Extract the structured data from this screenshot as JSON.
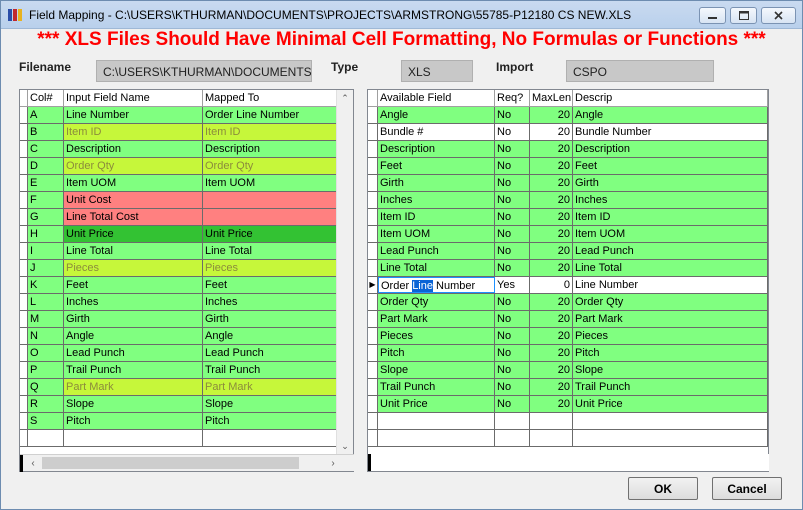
{
  "window": {
    "title": "Field Mapping - C:\\USERS\\KTHURMAN\\DOCUMENTS\\PROJECTS\\ARMSTRONG\\55785-P12180 CS NEW.XLS",
    "warning": "*** XLS Files Should Have Minimal Cell Formatting, No Formulas or Functions ***"
  },
  "form": {
    "filename_label": "Filename",
    "filename_value": "C:\\USERS\\KTHURMAN\\DOCUMENTS\\",
    "type_label": "Type",
    "type_value": "XLS",
    "import_label": "Import",
    "import_value": "CSPO"
  },
  "left_grid": {
    "headers": [
      "Col#",
      "Input Field Name",
      "Mapped To"
    ],
    "rows": [
      {
        "col": "A",
        "input": "Line Number",
        "mapped": "Order Line Number",
        "style": "g"
      },
      {
        "col": "B",
        "input": "Item ID",
        "mapped": "Item ID",
        "style": "y"
      },
      {
        "col": "C",
        "input": "Description",
        "mapped": "Description",
        "style": "g"
      },
      {
        "col": "D",
        "input": "Order Qty",
        "mapped": "Order Qty",
        "style": "y"
      },
      {
        "col": "E",
        "input": "Item UOM",
        "mapped": "Item UOM",
        "style": "g"
      },
      {
        "col": "F",
        "input": "Unit Cost",
        "mapped": "",
        "style": "r"
      },
      {
        "col": "G",
        "input": "Line Total Cost",
        "mapped": "",
        "style": "r"
      },
      {
        "col": "H",
        "input": "Unit Price",
        "mapped": "Unit Price",
        "style": "dg"
      },
      {
        "col": "I",
        "input": "Line Total",
        "mapped": "Line Total",
        "style": "g"
      },
      {
        "col": "J",
        "input": "Pieces",
        "mapped": "Pieces",
        "style": "y"
      },
      {
        "col": "K",
        "input": "Feet",
        "mapped": "Feet",
        "style": "g"
      },
      {
        "col": "L",
        "input": "Inches",
        "mapped": "Inches",
        "style": "g"
      },
      {
        "col": "M",
        "input": "Girth",
        "mapped": "Girth",
        "style": "g"
      },
      {
        "col": "N",
        "input": "Angle",
        "mapped": "Angle",
        "style": "g"
      },
      {
        "col": "O",
        "input": "Lead Punch",
        "mapped": "Lead Punch",
        "style": "g"
      },
      {
        "col": "P",
        "input": "Trail Punch",
        "mapped": "Trail Punch",
        "style": "g"
      },
      {
        "col": "Q",
        "input": "Part Mark",
        "mapped": "Part Mark",
        "style": "y"
      },
      {
        "col": "R",
        "input": "Slope",
        "mapped": "Slope",
        "style": "g"
      },
      {
        "col": "S",
        "input": "Pitch",
        "mapped": "Pitch",
        "style": "g"
      }
    ]
  },
  "right_grid": {
    "headers": [
      "Available Field",
      "Req?",
      "MaxLen",
      "Descrip"
    ],
    "rows": [
      {
        "field": "Angle",
        "req": "No",
        "maxlen": "20",
        "descrip": "Angle",
        "style": "g"
      },
      {
        "field": "Bundle #",
        "req": "No",
        "maxlen": "20",
        "descrip": "Bundle Number",
        "style": "w"
      },
      {
        "field": "Description",
        "req": "No",
        "maxlen": "20",
        "descrip": "Description",
        "style": "g"
      },
      {
        "field": "Feet",
        "req": "No",
        "maxlen": "20",
        "descrip": "Feet",
        "style": "g"
      },
      {
        "field": "Girth",
        "req": "No",
        "maxlen": "20",
        "descrip": "Girth",
        "style": "g"
      },
      {
        "field": "Inches",
        "req": "No",
        "maxlen": "20",
        "descrip": "Inches",
        "style": "g"
      },
      {
        "field": "Item ID",
        "req": "No",
        "maxlen": "20",
        "descrip": "Item ID",
        "style": "g"
      },
      {
        "field": "Item UOM",
        "req": "No",
        "maxlen": "20",
        "descrip": "Item UOM",
        "style": "g"
      },
      {
        "field": "Lead Punch",
        "req": "No",
        "maxlen": "20",
        "descrip": "Lead Punch",
        "style": "g"
      },
      {
        "field": "Line Total",
        "req": "No",
        "maxlen": "20",
        "descrip": "Line Total",
        "style": "g"
      },
      {
        "field": "Order Line Number",
        "req": "Yes",
        "maxlen": "0",
        "descrip": "Line Number",
        "style": "cur"
      },
      {
        "field": "Order Qty",
        "req": "No",
        "maxlen": "20",
        "descrip": "Order Qty",
        "style": "g"
      },
      {
        "field": "Part Mark",
        "req": "No",
        "maxlen": "20",
        "descrip": "Part Mark",
        "style": "g"
      },
      {
        "field": "Pieces",
        "req": "No",
        "maxlen": "20",
        "descrip": "Pieces",
        "style": "g"
      },
      {
        "field": "Pitch",
        "req": "No",
        "maxlen": "20",
        "descrip": "Pitch",
        "style": "g"
      },
      {
        "field": "Slope",
        "req": "No",
        "maxlen": "20",
        "descrip": "Slope",
        "style": "g"
      },
      {
        "field": "Trail Punch",
        "req": "No",
        "maxlen": "20",
        "descrip": "Trail Punch",
        "style": "g"
      },
      {
        "field": "Unit Price",
        "req": "No",
        "maxlen": "20",
        "descrip": "Unit Price",
        "style": "g"
      }
    ],
    "current_row_field_parts": [
      "Order",
      "Line",
      "Number"
    ]
  },
  "buttons": {
    "ok": "OK",
    "cancel": "Cancel"
  },
  "colors": {
    "mapped_green": "#80ff80",
    "unmapped_yellow": "#c6f73a",
    "unmapped_red": "#ff8080",
    "selected_green": "#33c233",
    "warning_red": "#ff0000"
  }
}
